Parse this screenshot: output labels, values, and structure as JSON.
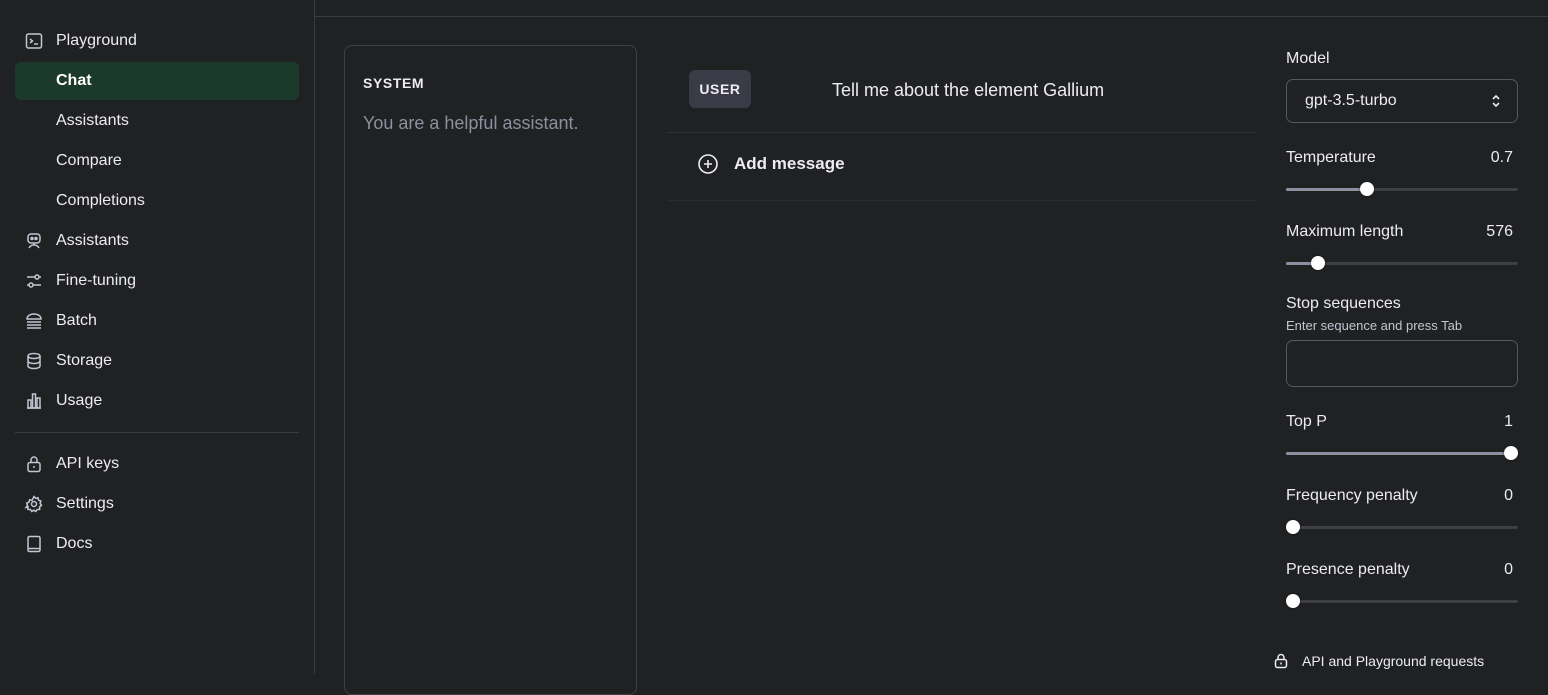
{
  "sidebar": {
    "items": [
      {
        "label": "Playground",
        "icon": "terminal-icon"
      },
      {
        "label": "Chat"
      },
      {
        "label": "Assistants"
      },
      {
        "label": "Compare"
      },
      {
        "label": "Completions"
      },
      {
        "label": "Assistants",
        "icon": "robot-icon"
      },
      {
        "label": "Fine-tuning",
        "icon": "sliders-icon"
      },
      {
        "label": "Batch",
        "icon": "layers-icon"
      },
      {
        "label": "Storage",
        "icon": "database-icon"
      },
      {
        "label": "Usage",
        "icon": "bar-chart-icon"
      },
      {
        "label": "API keys",
        "icon": "lock-icon"
      },
      {
        "label": "Settings",
        "icon": "gear-icon"
      },
      {
        "label": "Docs",
        "icon": "book-icon"
      }
    ]
  },
  "system": {
    "label": "SYSTEM",
    "text": "You are a helpful assistant."
  },
  "chat": {
    "role": "USER",
    "message": "Tell me about the element Gallium",
    "add_message": "Add message"
  },
  "settings": {
    "model_label": "Model",
    "model_value": "gpt-3.5-turbo",
    "temperature": {
      "label": "Temperature",
      "value": "0.7",
      "fraction": 0.35
    },
    "max_length": {
      "label": "Maximum length",
      "value": "576",
      "fraction": 0.14
    },
    "stop": {
      "label": "Stop sequences",
      "hint": "Enter sequence and press Tab",
      "value": ""
    },
    "top_p": {
      "label": "Top P",
      "value": "1",
      "fraction": 1.0
    },
    "frequency": {
      "label": "Frequency penalty",
      "value": "0",
      "fraction": 0.0
    },
    "presence": {
      "label": "Presence penalty",
      "value": "0",
      "fraction": 0.0
    },
    "footer": "API and Playground requests"
  },
  "colors": {
    "accent_active": "#1c3a2b",
    "background": "#202123"
  }
}
